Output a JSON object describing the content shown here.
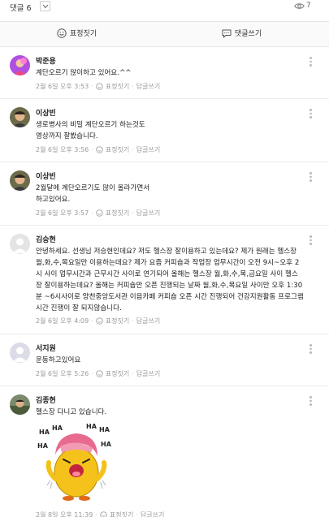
{
  "header": {
    "comment_label": "댓글 6",
    "view_count": "7"
  },
  "actions": {
    "react_label": "표정짓기",
    "write_label": "댓글쓰기"
  },
  "meta_labels": {
    "react": "표정짓기",
    "reply": "답글쓰기"
  },
  "comments": [
    {
      "author": "박준용",
      "text": "계단오르기 많이하고 있어요.^^",
      "time": "2월 6일 오후 3:53"
    },
    {
      "author": "이상빈",
      "text": "생로병사의 비밀 계단오르기 하는것도\n영상까지 잘봤습니다.",
      "time": "2월 6일 오후 3:56"
    },
    {
      "author": "이상빈",
      "text": "2월달에 계단오르기도 많이 올라가면서\n하고있어요.",
      "time": "2월 6일 오후 3:57"
    },
    {
      "author": "김승현",
      "text": "안녕하세요. 선생님 저승현인데요? 저도 헬스장 잘이용하고 있는데요? 제가 원래는 헬스장 월,화,수,목요일만 이용하는데요? 제가 요즘 커피숍과 작업장 업무시간이 오전 9시~오후 2시 사이 업무시간과 근무시간 사이로 연기되어 올해는 헬스장 월,화,수,목,금요일 사이 헬스장 잘이용하는데요? 올해는 커피숍만 오픈 진행되는 날짜 월,화,수,목요일 사이만 오후 1:30분 ~6시사이로 양천중앙도서관 이음카페 커피숍 오픈 시간 진행되어 건강지원활동 프로그램 시간 진행이 잘 되지않습니다.",
      "time": "2월 6일 오후 4:09"
    },
    {
      "author": "서지원",
      "text": "운동하고있어요",
      "time": "2월 6일 오후 5:26"
    },
    {
      "author": "김종현",
      "text": "헬스장 다니고 있습니다.",
      "time": "2월 8일 오후 11:39",
      "sticker_text": [
        "HA",
        "HA",
        "HA",
        "HA",
        "HA",
        "HA"
      ]
    }
  ],
  "colors": {
    "divider": "#ececec",
    "meta": "#999999",
    "sticker_yellow": "#f4c21a",
    "sticker_pink": "#e86a8e"
  }
}
